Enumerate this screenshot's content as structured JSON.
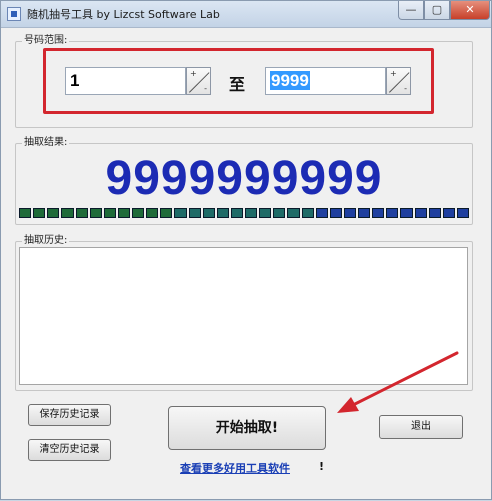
{
  "window": {
    "title": "随机抽号工具    by Lizcst Software Lab",
    "min_glyph": "—",
    "max_glyph": "▢",
    "close_glyph": "✕"
  },
  "range": {
    "label": "号码范围:",
    "start_value": "1",
    "to_label": "至",
    "end_value": "9999",
    "spin_up": "+",
    "spin_down": "-"
  },
  "result": {
    "label": "抽取结果:",
    "number": "9999999999",
    "progress_segments": 32,
    "progress_colors": [
      "#1f6b39",
      "#1f6b67",
      "#1f3f9f"
    ]
  },
  "history": {
    "label": "抽取历史:"
  },
  "buttons": {
    "save_history": "保存历史记录",
    "clear_history": "清空历史记录",
    "start": "开始抽取!",
    "exit": "退出"
  },
  "link": {
    "text": "查看更多好用工具软件",
    "suffix": "!"
  },
  "annotation": {
    "highlight_color": "#d3262e",
    "arrow_color": "#d3262e"
  }
}
